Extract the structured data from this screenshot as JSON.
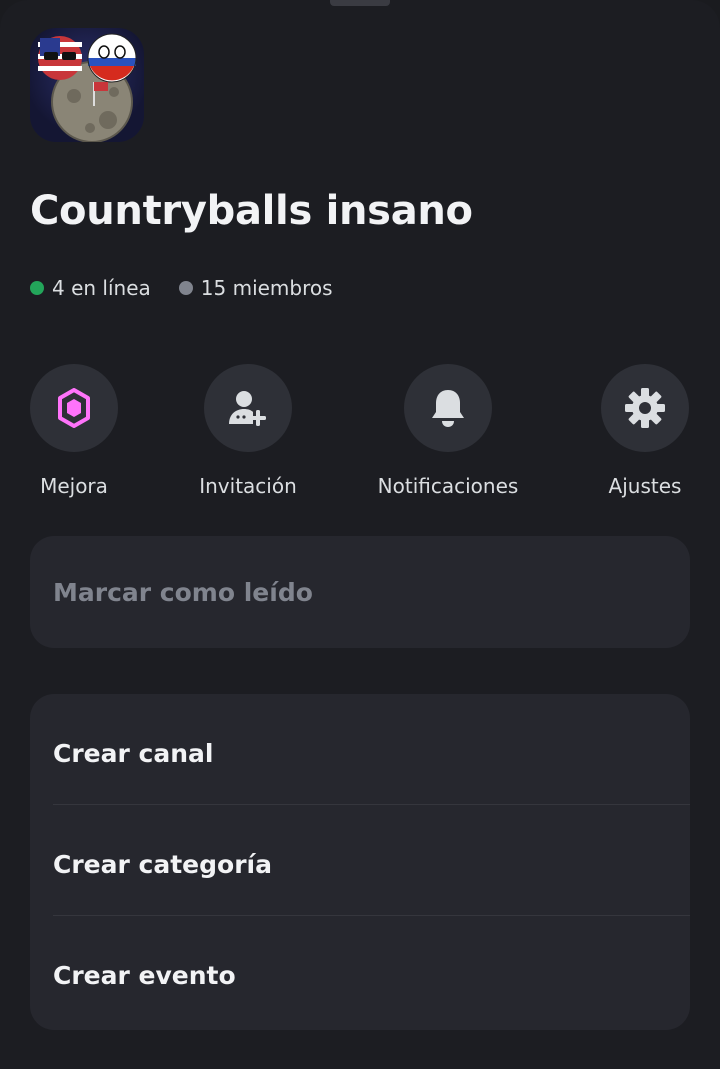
{
  "server": {
    "name": "Countryballs insano",
    "online_text": "4 en línea",
    "members_text": "15 miembros"
  },
  "actions": [
    {
      "label": "Mejora",
      "icon": "boost-gem-icon"
    },
    {
      "label": "Invitación",
      "icon": "add-user-icon"
    },
    {
      "label": "Notificaciones",
      "icon": "bell-icon"
    },
    {
      "label": "Ajustes",
      "icon": "gear-icon"
    }
  ],
  "mark_read": {
    "label": "Marcar como leído"
  },
  "create_menu": {
    "items": [
      {
        "label": "Crear canal"
      },
      {
        "label": "Crear categoría"
      },
      {
        "label": "Crear evento"
      }
    ]
  },
  "colors": {
    "background": "#1c1d22",
    "card": "#26272e",
    "online": "#23a55a",
    "boost": "#ff73fa"
  }
}
